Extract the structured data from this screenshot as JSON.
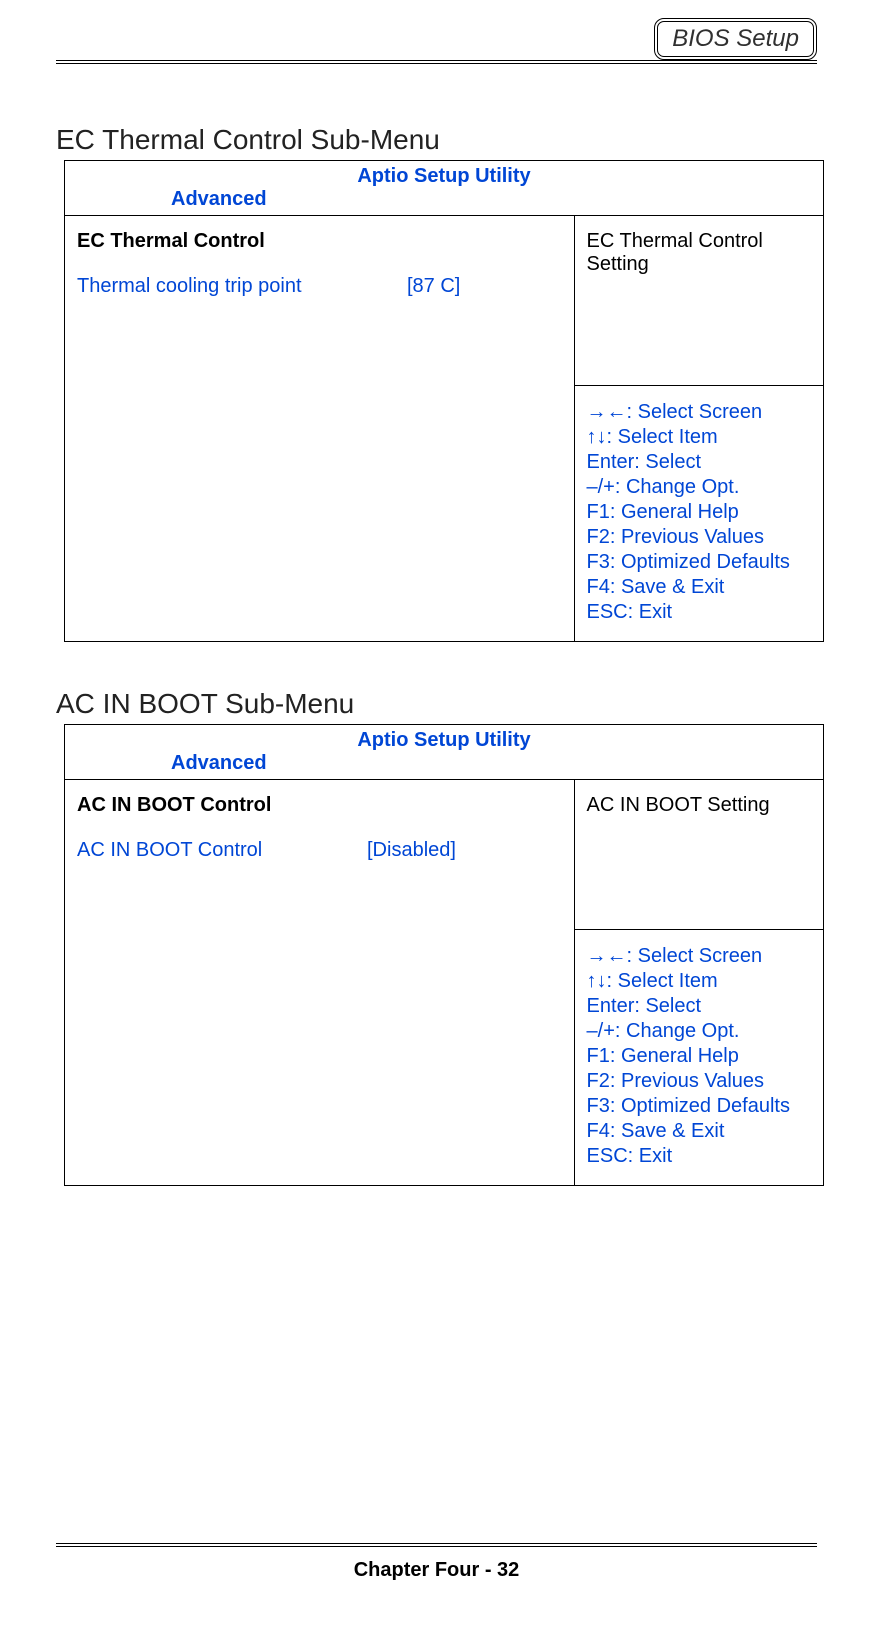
{
  "header": {
    "badge": "BIOS Setup"
  },
  "section1": {
    "title": "EC Thermal Control Sub-Menu",
    "utility_title": "Aptio Setup Utility",
    "tab": "Advanced",
    "panel_heading": "EC Thermal Control",
    "option_label": "Thermal cooling trip point",
    "option_value": "[87 C]",
    "description": "EC Thermal Control Setting",
    "help": [
      "→←: Select Screen",
      "↑↓: Select Item",
      "Enter: Select",
      "–/+: Change Opt.",
      "F1: General Help",
      "F2: Previous Values",
      "F3: Optimized Defaults",
      "F4: Save & Exit",
      "ESC: Exit"
    ]
  },
  "section2": {
    "title": "AC IN BOOT Sub-Menu",
    "utility_title": "Aptio Setup Utility",
    "tab": "Advanced",
    "panel_heading": "AC IN BOOT Control",
    "option_label": "AC IN BOOT Control",
    "option_value": "[Disabled]",
    "description": "AC IN BOOT Setting",
    "help": [
      "→←: Select Screen",
      "↑↓: Select Item",
      "Enter: Select",
      "–/+: Change Opt.",
      "F1: General Help",
      "F2: Previous Values",
      "F3: Optimized Defaults",
      "F4: Save & Exit",
      "ESC: Exit"
    ]
  },
  "footer": {
    "text": "Chapter Four - 32"
  }
}
